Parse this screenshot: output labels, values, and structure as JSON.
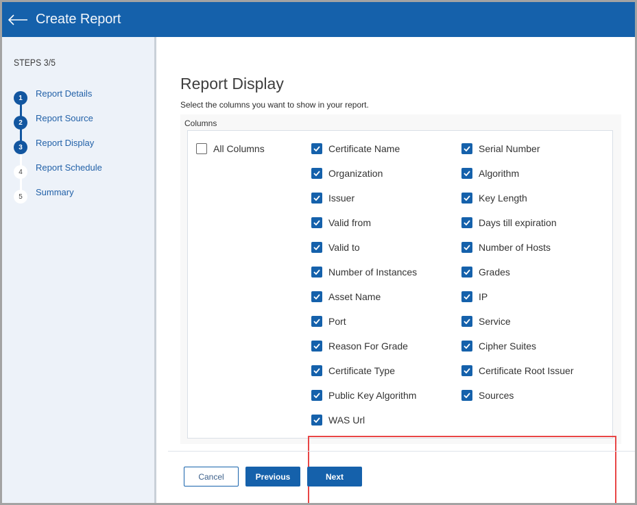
{
  "header": {
    "title": "Create Report",
    "back_icon": "arrow-left-icon",
    "color": "#1561ab"
  },
  "sidebar": {
    "steps_label": "STEPS 3/5",
    "current_step": 3,
    "total_steps": 5,
    "steps": [
      {
        "number": "1",
        "label": "Report Details",
        "completed": true
      },
      {
        "number": "2",
        "label": "Report Source",
        "completed": true
      },
      {
        "number": "3",
        "label": "Report Display",
        "completed": true
      },
      {
        "number": "4",
        "label": "Report Schedule",
        "completed": false
      },
      {
        "number": "5",
        "label": "Summary",
        "completed": false
      }
    ]
  },
  "main": {
    "title": "Report Display",
    "subtitle": "Select the columns you want to show in your report.",
    "columns_label": "Columns",
    "all_columns": {
      "label": "All Columns",
      "checked": false
    },
    "left_column": [
      {
        "label": "Certificate Name",
        "checked": true
      },
      {
        "label": "Organization",
        "checked": true
      },
      {
        "label": "Issuer",
        "checked": true
      },
      {
        "label": "Valid from",
        "checked": true
      },
      {
        "label": "Valid to",
        "checked": true
      },
      {
        "label": "Number of Instances",
        "checked": true
      },
      {
        "label": "Asset Name",
        "checked": true
      },
      {
        "label": "Port",
        "checked": true
      },
      {
        "label": "Reason For Grade",
        "checked": true
      },
      {
        "label": "Certificate Type",
        "checked": true
      },
      {
        "label": "Public Key Algorithm",
        "checked": true
      },
      {
        "label": "WAS Url",
        "checked": true
      }
    ],
    "right_column": [
      {
        "label": "Serial Number",
        "checked": true
      },
      {
        "label": "Algorithm",
        "checked": true
      },
      {
        "label": "Key Length",
        "checked": true
      },
      {
        "label": "Days till expiration",
        "checked": true
      },
      {
        "label": "Number of Hosts",
        "checked": true
      },
      {
        "label": "Grades",
        "checked": true
      },
      {
        "label": "IP",
        "checked": true
      },
      {
        "label": "Service",
        "checked": true
      },
      {
        "label": "Cipher Suites",
        "checked": true
      },
      {
        "label": "Certificate Root Issuer",
        "checked": true
      },
      {
        "label": "Sources",
        "checked": true
      }
    ],
    "highlight_color": "#e84545"
  },
  "footer": {
    "cancel_label": "Cancel",
    "previous_label": "Previous",
    "next_label": "Next"
  }
}
